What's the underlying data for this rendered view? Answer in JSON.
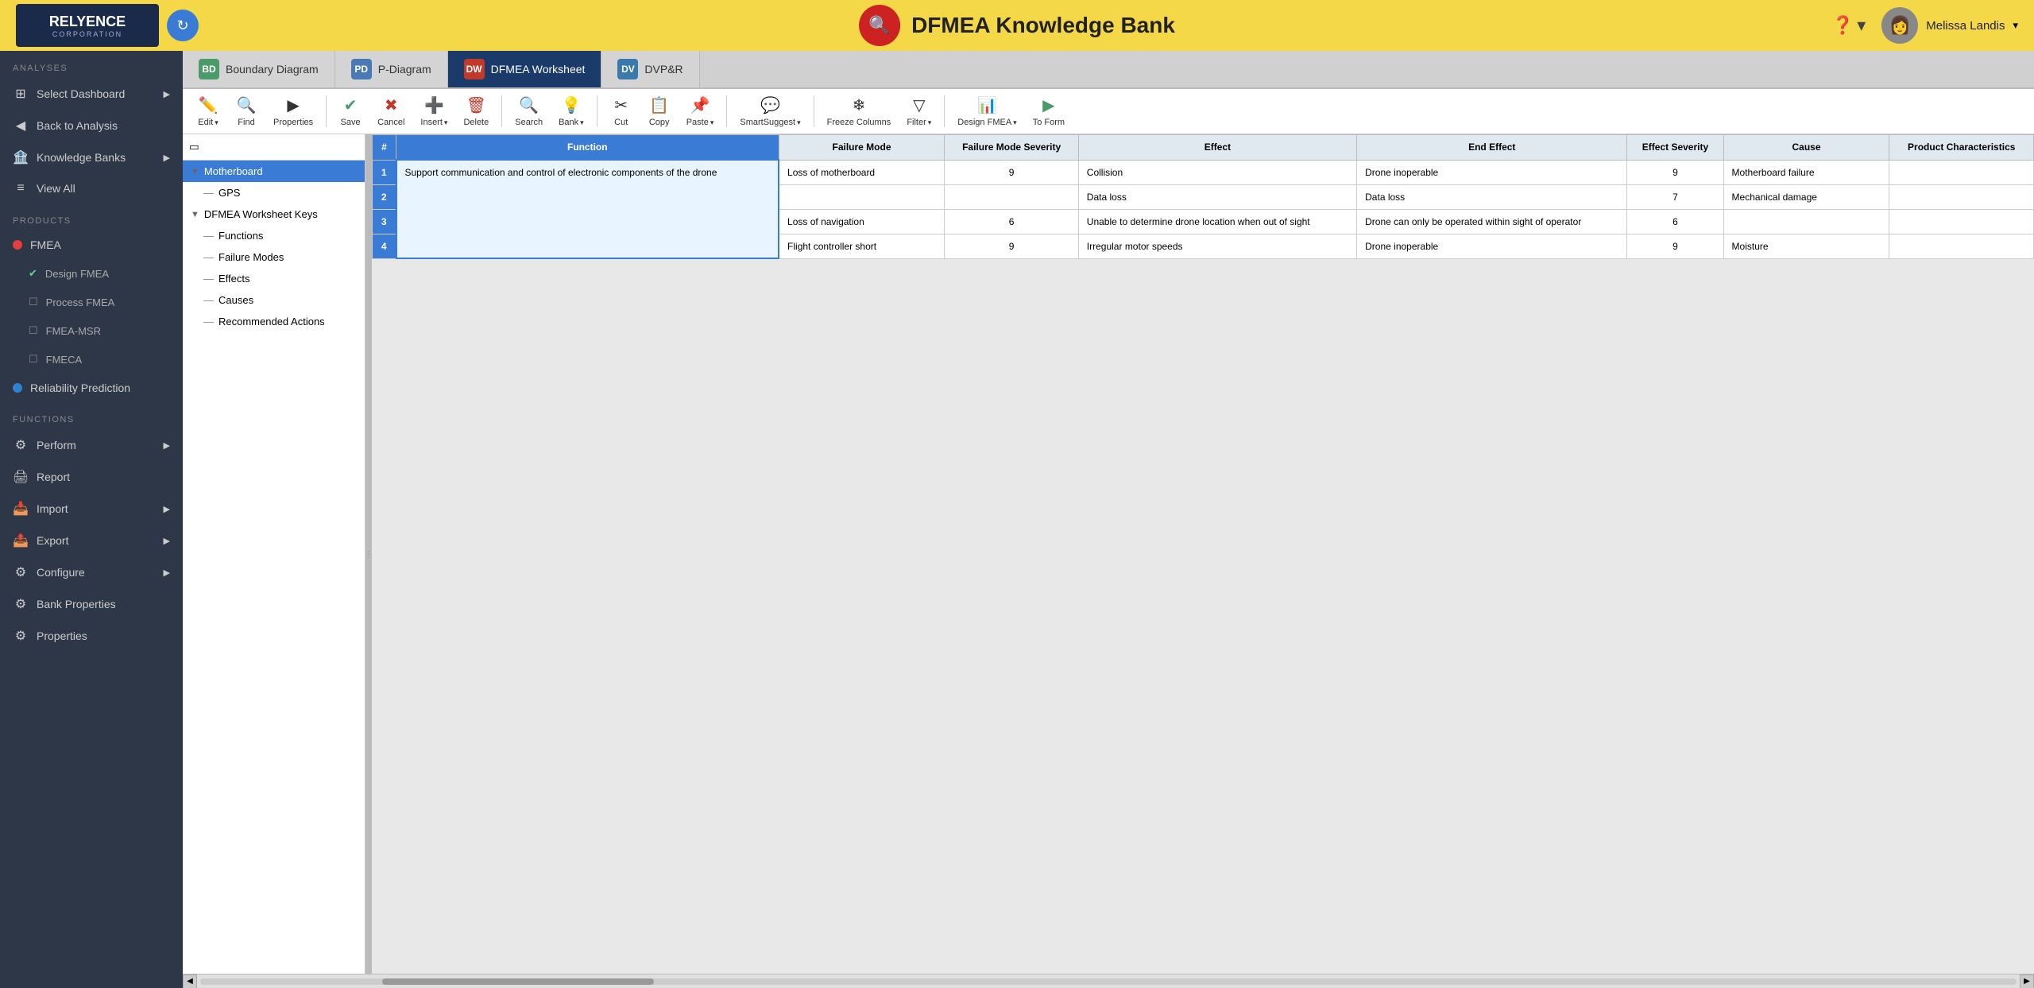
{
  "header": {
    "logo_text": "RELYENCE",
    "logo_sub": "CORPORATION",
    "title": "DFMEA Knowledge Bank",
    "user_name": "Melissa Landis",
    "help_label": "?"
  },
  "tabs": [
    {
      "id": "bd",
      "badge": "BD",
      "label": "Boundary Diagram",
      "badge_color": "#4a9a6a",
      "active": false
    },
    {
      "id": "pd",
      "badge": "PD",
      "label": "P-Diagram",
      "badge_color": "#4a7ab5",
      "active": false
    },
    {
      "id": "dw",
      "badge": "DW",
      "label": "DFMEA Worksheet",
      "badge_color": "#c0392b",
      "active": true
    },
    {
      "id": "dv",
      "badge": "DV",
      "label": "DVP&R",
      "badge_color": "#3a7aaa",
      "active": false
    }
  ],
  "toolbar": {
    "edit_label": "Edit",
    "find_label": "Find",
    "properties_label": "Properties",
    "save_label": "Save",
    "cancel_label": "Cancel",
    "insert_label": "Insert",
    "delete_label": "Delete",
    "search_label": "Search",
    "bank_label": "Bank",
    "cut_label": "Cut",
    "copy_label": "Copy",
    "paste_label": "Paste",
    "smart_suggest_label": "SmartSuggest",
    "freeze_columns_label": "Freeze Columns",
    "filter_label": "Filter",
    "design_fmea_label": "Design FMEA",
    "to_form_label": "To Form"
  },
  "sidebar": {
    "analyses_label": "ANALYSES",
    "products_label": "PRODUCTS",
    "functions_label": "FUNCTIONS",
    "items": [
      {
        "id": "select-dashboard",
        "label": "Select Dashboard",
        "icon": "⊞",
        "has_arrow": true
      },
      {
        "id": "back-to-analysis",
        "label": "Back to Analysis",
        "icon": "◀",
        "has_arrow": false
      },
      {
        "id": "knowledge-banks",
        "label": "Knowledge Banks",
        "icon": "🏦",
        "has_arrow": true
      },
      {
        "id": "view-all",
        "label": "View All",
        "icon": "≡",
        "has_arrow": false
      }
    ],
    "products": [
      {
        "id": "fmea",
        "label": "FMEA",
        "dot": "red"
      },
      {
        "id": "design-fmea",
        "label": "Design FMEA",
        "dot": "checked"
      },
      {
        "id": "process-fmea",
        "label": "Process FMEA",
        "dot": "empty"
      },
      {
        "id": "fmea-msr",
        "label": "FMEA-MSR",
        "dot": "empty"
      },
      {
        "id": "fmeca",
        "label": "FMECA",
        "dot": "empty"
      },
      {
        "id": "reliability-prediction",
        "label": "Reliability Prediction",
        "dot": "blue"
      }
    ],
    "functions_items": [
      {
        "id": "perform",
        "label": "Perform",
        "icon": "⚙",
        "has_arrow": true
      },
      {
        "id": "report",
        "label": "Report",
        "icon": "🖨",
        "has_arrow": false
      },
      {
        "id": "import",
        "label": "Import",
        "icon": "📥",
        "has_arrow": true
      },
      {
        "id": "export",
        "label": "Export",
        "icon": "📤",
        "has_arrow": true
      },
      {
        "id": "configure",
        "label": "Configure",
        "icon": "⚙",
        "has_arrow": true
      },
      {
        "id": "bank-properties",
        "label": "Bank Properties",
        "icon": "⚙",
        "has_arrow": false
      },
      {
        "id": "properties",
        "label": "Properties",
        "icon": "⚙",
        "has_arrow": false
      }
    ]
  },
  "tree": {
    "items": [
      {
        "id": "motherboard",
        "label": "Motherboard",
        "level": 0,
        "selected": true,
        "expandable": true
      },
      {
        "id": "gps",
        "label": "GPS",
        "level": 1,
        "selected": false,
        "expandable": false
      },
      {
        "id": "dfmea-keys",
        "label": "DFMEA Worksheet Keys",
        "level": 0,
        "selected": false,
        "expandable": true
      },
      {
        "id": "functions",
        "label": "Functions",
        "level": 1,
        "selected": false,
        "expandable": false
      },
      {
        "id": "failure-modes",
        "label": "Failure Modes",
        "level": 1,
        "selected": false,
        "expandable": false
      },
      {
        "id": "effects",
        "label": "Effects",
        "level": 1,
        "selected": false,
        "expandable": false
      },
      {
        "id": "causes",
        "label": "Causes",
        "level": 1,
        "selected": false,
        "expandable": false
      },
      {
        "id": "recommended-actions",
        "label": "Recommended Actions",
        "level": 1,
        "selected": false,
        "expandable": false
      }
    ]
  },
  "table": {
    "columns": [
      {
        "id": "num",
        "label": "#"
      },
      {
        "id": "function",
        "label": "Function"
      },
      {
        "id": "failure-mode",
        "label": "Failure Mode"
      },
      {
        "id": "failure-mode-severity",
        "label": "Failure Mode Severity"
      },
      {
        "id": "effect",
        "label": "Effect"
      },
      {
        "id": "end-effect",
        "label": "End Effect"
      },
      {
        "id": "effect-severity",
        "label": "Effect Severity"
      },
      {
        "id": "cause",
        "label": "Cause"
      },
      {
        "id": "product-characteristics",
        "label": "Product Characteristics"
      }
    ],
    "rows": [
      {
        "row_num": "1",
        "function": "Support communication and control of electronic components of the drone",
        "failure_mode": "Loss of motherboard",
        "failure_mode_severity": "9",
        "effect": "Collision",
        "end_effect": "Drone inoperable",
        "effect_severity": "9",
        "cause": "Motherboard failure",
        "product_char": ""
      },
      {
        "row_num": "2",
        "function": "",
        "failure_mode": "",
        "failure_mode_severity": "",
        "effect": "Data loss",
        "end_effect": "Data loss",
        "effect_severity": "7",
        "cause": "Mechanical damage",
        "product_char": ""
      },
      {
        "row_num": "3",
        "function": "",
        "failure_mode": "Loss of navigation",
        "failure_mode_severity": "6",
        "effect": "Unable to determine drone location when out of sight",
        "end_effect": "Drone can only be operated within sight of operator",
        "effect_severity": "6",
        "cause": "",
        "product_char": ""
      },
      {
        "row_num": "4",
        "function": "",
        "failure_mode": "Flight controller short",
        "failure_mode_severity": "9",
        "effect": "Irregular motor speeds",
        "end_effect": "Drone inoperable",
        "effect_severity": "9",
        "cause": "Moisture",
        "product_char": ""
      }
    ]
  }
}
